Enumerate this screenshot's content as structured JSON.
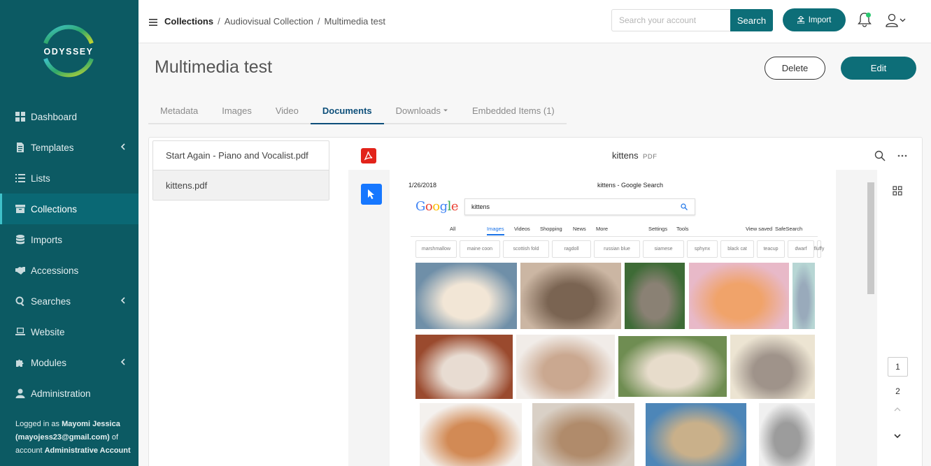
{
  "brand": {
    "name": "ODYSSEY"
  },
  "sidebar": {
    "items": [
      {
        "label": "Dashboard",
        "icon": "dashboard-icon",
        "has_caret": false,
        "active": false
      },
      {
        "label": "Templates",
        "icon": "file-icon",
        "has_caret": true,
        "active": false
      },
      {
        "label": "Lists",
        "icon": "list-icon",
        "has_caret": false,
        "active": false
      },
      {
        "label": "Collections",
        "icon": "archive-icon",
        "has_caret": false,
        "active": true
      },
      {
        "label": "Imports",
        "icon": "database-icon",
        "has_caret": false,
        "active": false
      },
      {
        "label": "Accessions",
        "icon": "handshake-icon",
        "has_caret": false,
        "active": false
      },
      {
        "label": "Searches",
        "icon": "search-icon",
        "has_caret": true,
        "active": false
      },
      {
        "label": "Website",
        "icon": "laptop-icon",
        "has_caret": false,
        "active": false
      },
      {
        "label": "Modules",
        "icon": "puzzle-icon",
        "has_caret": true,
        "active": false
      },
      {
        "label": "Administration",
        "icon": "user-icon",
        "has_caret": false,
        "active": false
      }
    ],
    "login": {
      "prefix": "Logged in as ",
      "name": "Mayomi Jessica",
      "email": "(mayojess23@gmail.com)",
      "mid": " of account ",
      "account": "Administrative Account"
    }
  },
  "topbar": {
    "breadcrumb": [
      "Collections",
      "Audiovisual Collection",
      "Multimedia test"
    ],
    "search_placeholder": "Search your account",
    "search_label": "Search",
    "import_label": "Import"
  },
  "header": {
    "title": "Multimedia test",
    "delete_label": "Delete",
    "edit_label": "Edit"
  },
  "tabs": [
    {
      "label": "Metadata",
      "active": false
    },
    {
      "label": "Images",
      "active": false
    },
    {
      "label": "Video",
      "active": false
    },
    {
      "label": "Documents",
      "active": true
    },
    {
      "label": "Downloads",
      "active": false,
      "dropdown": true
    },
    {
      "label": "Embedded Items (1)",
      "active": false
    }
  ],
  "files": [
    {
      "name": "Start Again - Piano and Vocalist.pdf",
      "selected": false
    },
    {
      "name": "kittens.pdf",
      "selected": true
    }
  ],
  "viewer": {
    "doc_title": "kittens",
    "doc_type": "PDF",
    "pages": [
      "1",
      "2"
    ],
    "current_page": "1"
  },
  "pdf_page": {
    "date": "1/26/2018",
    "title": "kittens - Google Search",
    "logo": "Google",
    "query": "kittens",
    "nav": [
      "All",
      "Images",
      "Videos",
      "Shopping",
      "News",
      "More",
      "Settings",
      "Tools",
      "View saved",
      "SafeSearch"
    ],
    "chips": [
      "marshmallow",
      "maine coon",
      "scottish fold",
      "ragdoll",
      "russian blue",
      "siamese",
      "sphynx",
      "black cat",
      "teacup",
      "dwarf",
      "fluffy"
    ]
  },
  "colors": {
    "sidebar": "#0c5a63",
    "accent": "#0d6e78",
    "active_tab": "#0d4f7a"
  }
}
